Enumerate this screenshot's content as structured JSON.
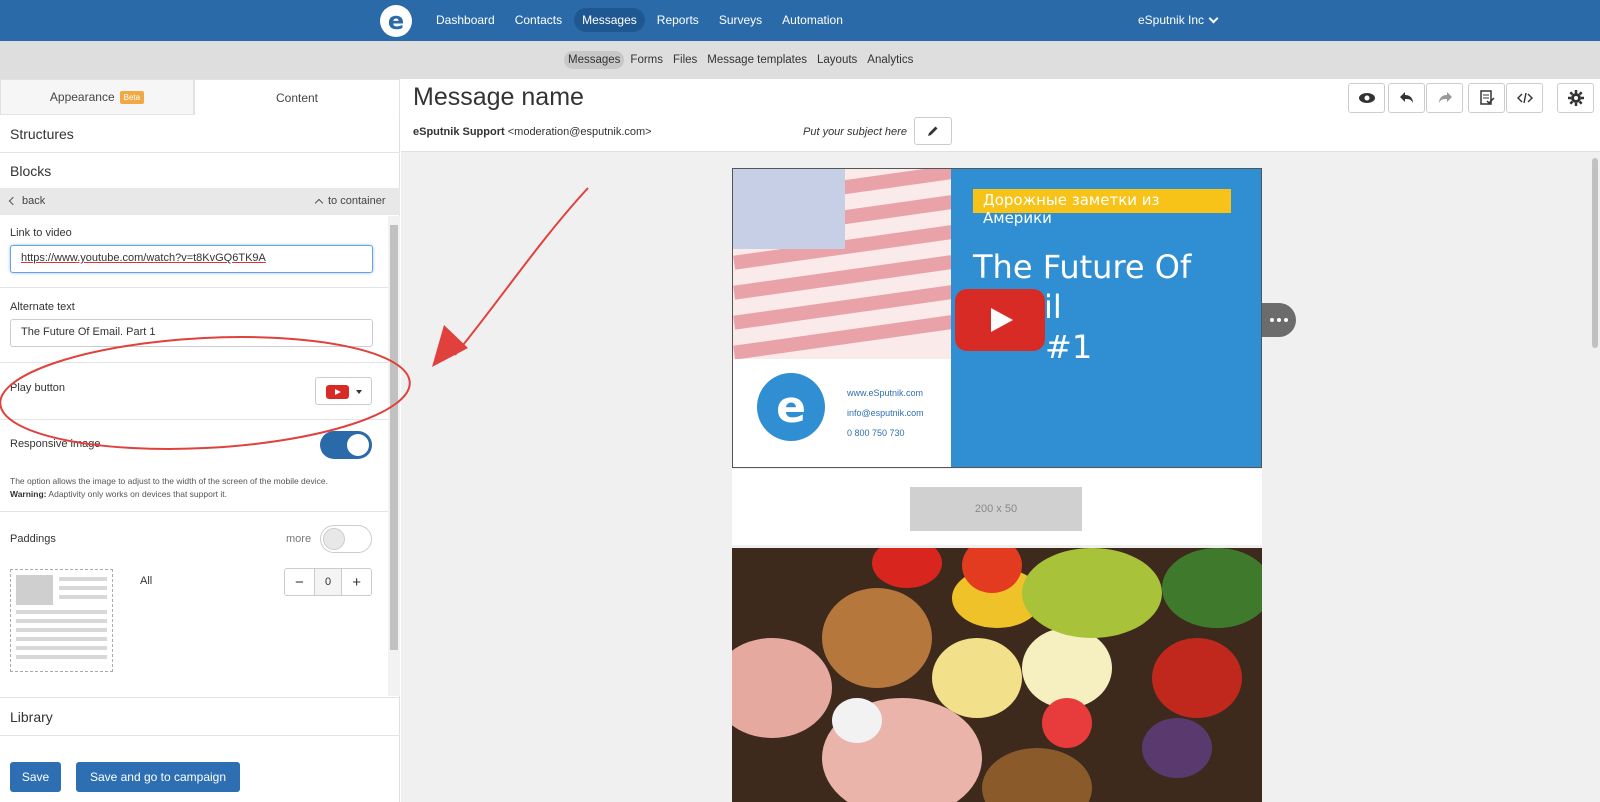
{
  "nav": {
    "items": [
      "Dashboard",
      "Contacts",
      "Messages",
      "Reports",
      "Surveys",
      "Automation"
    ],
    "active": "Messages",
    "account": "eSputnik Inc"
  },
  "subnav": {
    "items": [
      "Messages",
      "Forms",
      "Files",
      "Message templates",
      "Layouts",
      "Analytics"
    ],
    "active": "Messages"
  },
  "left": {
    "tabs": {
      "appearance": "Appearance",
      "beta": "Beta",
      "content": "Content"
    },
    "sections": {
      "structures": "Structures",
      "blocks": "Blocks",
      "library": "Library"
    },
    "back": "back",
    "to_container": "to container",
    "link_label": "Link to video",
    "link_value": "https://www.youtube.com/watch?v=t8KvGQ6TK9A",
    "alt_label": "Alternate text",
    "alt_value": "The Future Of Email. Part 1",
    "play_label": "Play button",
    "responsive_label": "Responsive image",
    "responsive_on": true,
    "help_text": "The option allows the image to adjust to the width of the screen of the mobile device.",
    "warning_label": "Warning:",
    "warning_text": "Adaptivity only works on devices that support it.",
    "paddings_label": "Paddings",
    "more_label": "more",
    "all_label": "All",
    "padding_value": "0",
    "save": "Save",
    "save_go": "Save and go to campaign"
  },
  "editor": {
    "title": "Message name",
    "sender_name": "eSputnik Support",
    "sender_email": "<moderation@esputnik.com>",
    "subject_placeholder": "Put your subject here",
    "banner": {
      "ribbon": "Дорожные заметки из Америки",
      "title_line1": "The Future Of Email",
      "title_line2": "#1",
      "site": "www.eSputnik.com",
      "email": "info@esputnik.com",
      "phone": "0 800 750 730"
    },
    "placeholder": "200 x 50"
  },
  "colors": {
    "nav": "#2a6aa8",
    "accent": "#2d6fb2",
    "annotation": "#e0413c",
    "youtube": "#d92b26"
  }
}
